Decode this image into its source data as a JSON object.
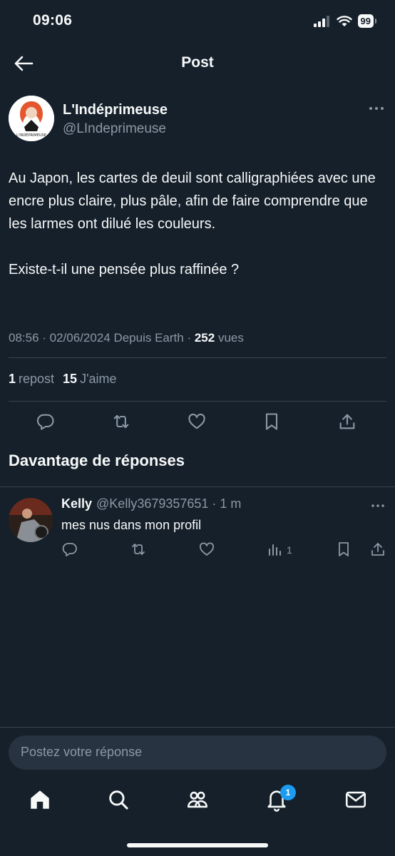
{
  "status_bar": {
    "time": "09:06",
    "battery": "99"
  },
  "header": {
    "title": "Post"
  },
  "post": {
    "author_name": "L'Indéprimeuse",
    "author_handle": "@LIndeprimeuse",
    "avatar_text": "L'INDÉPRIMEUSE",
    "paragraph1": "Au Japon, les cartes de deuil sont calligraphiées avec une encre plus claire, plus pâle, afin de faire comprendre que les larmes ont dilué les couleurs.",
    "paragraph2": "Existe-t-il une pensée plus raffinée ?",
    "meta_time": "08:56 · 02/06/2024 Depuis Earth · ",
    "views_count": "252",
    "views_label": " vues",
    "reposts_count": "1",
    "reposts_label": "repost",
    "likes_count": "15",
    "likes_label": "J'aime"
  },
  "replies_section": {
    "title": "Davantage de réponses"
  },
  "reply": {
    "name": "Kelly",
    "handle_time": "@Kelly3679357651 · 1 m",
    "text": "mes nus dans mon profil",
    "views": "1"
  },
  "compose": {
    "placeholder": "Postez votre réponse"
  },
  "tabbar": {
    "notification_badge": "1"
  },
  "colors": {
    "background": "#15202b",
    "text": "#f7f9f9",
    "muted": "#8b98a5",
    "accent": "#1d9bf0",
    "divider": "#38444d"
  }
}
